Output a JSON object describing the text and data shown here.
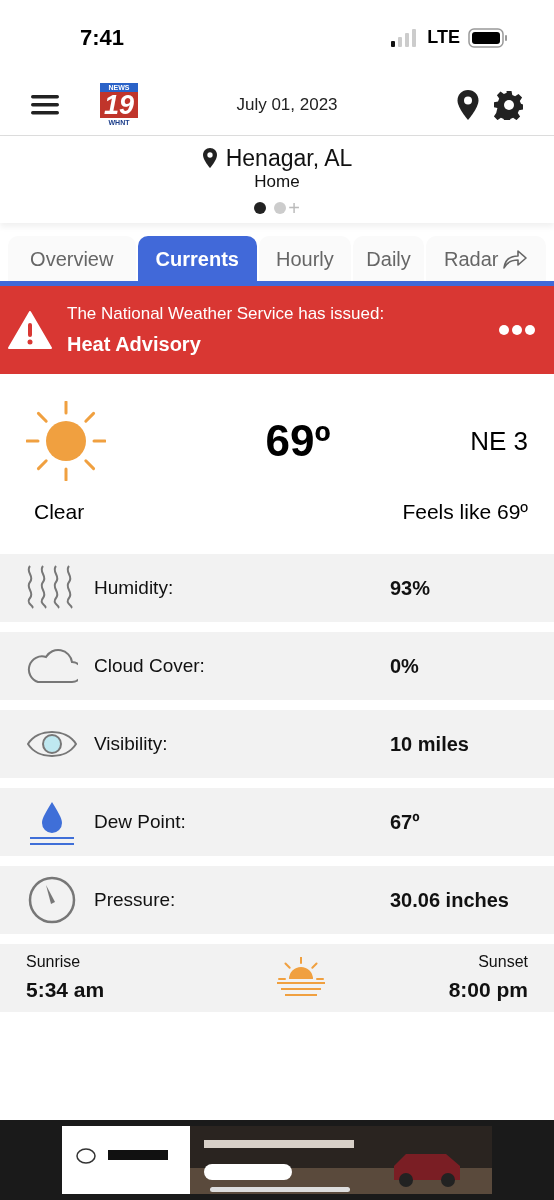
{
  "status_bar": {
    "time": "7:41",
    "network": "LTE"
  },
  "header": {
    "logo": {
      "top": "NEWS",
      "number": "19",
      "bottom": "WHNT"
    },
    "date": "July 01, 2023"
  },
  "location": {
    "name": "Henagar, AL",
    "label": "Home",
    "pages": [
      {
        "selected": true
      },
      {
        "selected": false
      }
    ],
    "add": "+"
  },
  "tabs": [
    {
      "label": "Overview",
      "selected": false
    },
    {
      "label": "Currents",
      "selected": true
    },
    {
      "label": "Hourly",
      "selected": false
    },
    {
      "label": "Daily",
      "selected": false
    },
    {
      "label": "Radar",
      "selected": false,
      "kind": "external"
    }
  ],
  "alert": {
    "intro": "The National Weather Service has issued:",
    "title": "Heat Advisory"
  },
  "current": {
    "temperature": "69º",
    "wind": "NE 3",
    "condition": "Clear",
    "feels_like": "Feels like 69º"
  },
  "details": [
    {
      "kind": "humidity",
      "label": "Humidity:",
      "value": "93%"
    },
    {
      "kind": "cloud",
      "label": "Cloud Cover:",
      "value": "0%"
    },
    {
      "kind": "visibility",
      "label": "Visibility:",
      "value": "10 miles"
    },
    {
      "kind": "dew",
      "label": "Dew Point:",
      "value": "67º"
    },
    {
      "kind": "pressure",
      "label": "Pressure:",
      "value": "30.06 inches"
    }
  ],
  "sun": {
    "sunrise_label": "Sunrise",
    "sunrise": "5:34 am",
    "sunset_label": "Sunset",
    "sunset": "8:00 pm"
  }
}
